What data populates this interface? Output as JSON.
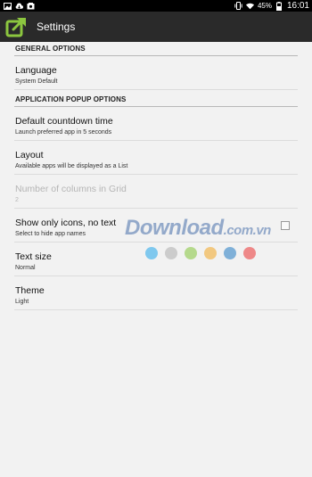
{
  "status_bar": {
    "battery_percent": "45%",
    "time": "16:01",
    "left_icons": [
      "image-icon",
      "cloud-icon",
      "sync-icon"
    ],
    "right_icons": [
      "phone-vibrate-icon",
      "wifi-icon",
      "battery-icon"
    ]
  },
  "action_bar": {
    "title": "Settings",
    "icon": "launch-app-icon",
    "icon_color": "#8cc63f"
  },
  "sections": [
    {
      "header": "GENERAL OPTIONS",
      "items": [
        {
          "title": "Language",
          "summary": "System Default",
          "enabled": true
        }
      ]
    },
    {
      "header": "APPLICATION POPUP OPTIONS",
      "items": [
        {
          "title": "Default countdown time",
          "summary": "Launch preferred app in 5 seconds",
          "enabled": true
        },
        {
          "title": "Layout",
          "summary": "Available apps will be displayed as a List",
          "enabled": true
        },
        {
          "title": "Number of columns in Grid",
          "summary": "2",
          "enabled": false
        },
        {
          "title": "Show only icons, no text",
          "summary": "Select to hide app names",
          "enabled": true,
          "checkbox": false
        },
        {
          "title": "Text size",
          "summary": "Normal",
          "enabled": true
        },
        {
          "title": "Theme",
          "summary": "Light",
          "enabled": true
        }
      ]
    }
  ],
  "watermark": {
    "text": "Download",
    "domain": ".com.vn",
    "dot_colors": [
      "#7fc8ee",
      "#cccccc",
      "#b5d98c",
      "#f2c880",
      "#7fb0d8",
      "#ee8888"
    ]
  }
}
